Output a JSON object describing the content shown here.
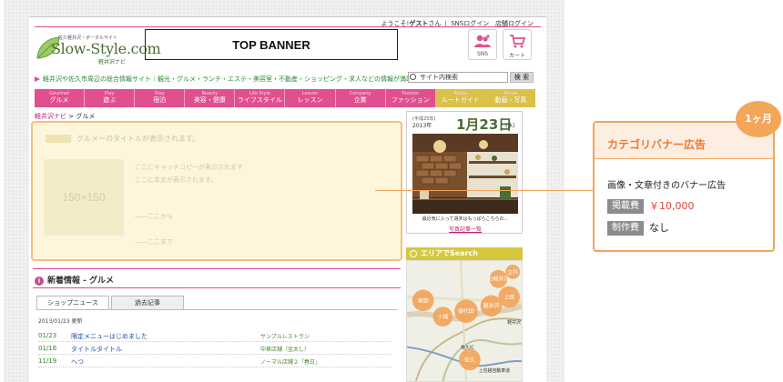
{
  "header": {
    "welcome_prefix": "ようこそ!",
    "guest": "ゲスト",
    "welcome_suffix": "さん",
    "sns_login": "SNSログイン",
    "shop_login": "店舗ログイン"
  },
  "logo": {
    "tagline": "佐久軽井沢・ポータルサイト",
    "name": "Slow-Style.com",
    "sub": "軽井沢ナビ"
  },
  "banner": {
    "label": "TOP BANNER"
  },
  "icons": {
    "sns_label": "SNS",
    "cart_label": "カート"
  },
  "catch_copy": "軽井沢や佐久市周辺の総合情報サイト｜観光・グルメ・ランチ・エステ・美容室・不動産・ショッピング・求人などの情報が満載！",
  "search": {
    "value": "サイト内検索",
    "button": "検 索"
  },
  "nav": [
    {
      "en": "Gourmet",
      "jp": "グルメ"
    },
    {
      "en": "Play",
      "jp": "遊ぶ"
    },
    {
      "en": "Stay",
      "jp": "宿泊"
    },
    {
      "en": "Beauty",
      "jp": "美容・健康"
    },
    {
      "en": "Life Style",
      "jp": "ライフスタイル"
    },
    {
      "en": "Lesson",
      "jp": "レッスン"
    },
    {
      "en": "Company",
      "jp": "企業"
    },
    {
      "en": "Fashion",
      "jp": "ファッション"
    },
    {
      "en": "Route",
      "jp": "ルートガイド"
    },
    {
      "en": "Movie",
      "jp": "動画・写真"
    }
  ],
  "breadcrumb": {
    "home": "軽井沢ナビ",
    "sep": ">",
    "current": "グルメ"
  },
  "category_banner": {
    "title": "グルメーのタイトルが表示されます。",
    "image_label": "150×150",
    "copy": "ここにキャッチコピーが表示されます",
    "body": "ここに本文が表示されます。",
    "from": "――ここから",
    "to": "――ここまで"
  },
  "news": {
    "heading": "新着情報 - グルメ",
    "tabs": [
      "ショップニュース",
      "過去記事"
    ],
    "updated": "2013/01/23 更新",
    "items": [
      {
        "date": "01/23",
        "title": "限定メニューはじめました",
        "shop": "サンプルレストラン"
      },
      {
        "date": "01/16",
        "title": "タイトルタイトル",
        "shop": "中華店舗（金太し）"
      },
      {
        "date": "11/19",
        "title": "へつ",
        "shop": "ノーマル店舗２「春日」"
      }
    ]
  },
  "photo": {
    "era": "(平成25年)",
    "year": "2013年",
    "day": "1月23日",
    "weekday": "(水)",
    "caption": "最近気に入って週末はもっぱらこちらの...",
    "more": "写真記事一覧"
  },
  "area": {
    "heading": "エリアでSearch",
    "bubbles": [
      "東御",
      "小諸",
      "御代田",
      "軽井沢",
      "佐久",
      "上田",
      "北軽井沢",
      "立科"
    ],
    "map_texts": [
      "軽井沢",
      "佐久IC",
      "上信越自動車道"
    ]
  },
  "callout": {
    "period": "1ヶ月",
    "title": "カテゴリバナー広告",
    "desc": "画像・文章付きのバナー広告",
    "fee_label": "掲載費",
    "fee_value": "￥10,000",
    "prod_label": "制作費",
    "prod_value": "なし"
  },
  "colors": {
    "accent_pink": "#e14f8e",
    "callout_orange": "#f3a55a",
    "fee_red": "#e24040"
  }
}
